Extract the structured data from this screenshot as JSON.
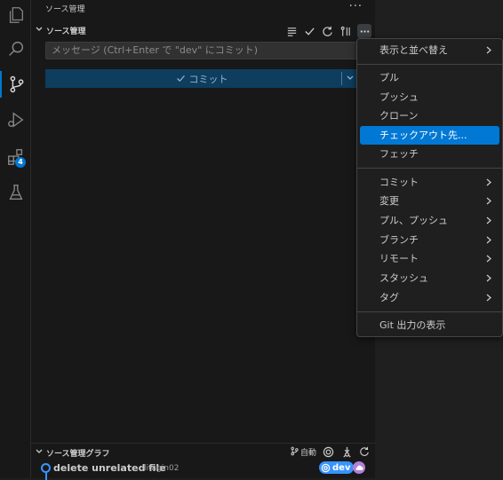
{
  "activity_bar": {
    "items": [
      "files-icon",
      "search-icon",
      "source-control-icon",
      "run-debug-icon",
      "extensions-icon",
      "testing-icon"
    ],
    "extensions_badge": "4"
  },
  "sidebar": {
    "view_title": "ソース管理",
    "section_title": "ソース管理",
    "commit_message_placeholder": "メッセージ (Ctrl+Enter で \"dev\" にコミット)",
    "commit_button_label": "コミット"
  },
  "graph": {
    "title": "ソース管理グラフ",
    "auto_label": "自動",
    "commit": {
      "message": "delete unrelated file",
      "author": "litagin02",
      "branch": "dev"
    }
  },
  "menu": {
    "items": [
      {
        "label": "表示と並べ替え",
        "submenu": true
      },
      {
        "label": "プル"
      },
      {
        "label": "プッシュ"
      },
      {
        "label": "クローン"
      },
      {
        "label": "チェックアウト先...",
        "highlighted": true
      },
      {
        "label": "フェッチ"
      },
      {
        "label": "コミット",
        "submenu": true
      },
      {
        "label": "変更",
        "submenu": true
      },
      {
        "label": "プル、プッシュ",
        "submenu": true
      },
      {
        "label": "ブランチ",
        "submenu": true
      },
      {
        "label": "リモート",
        "submenu": true
      },
      {
        "label": "スタッシュ",
        "submenu": true
      },
      {
        "label": "タグ",
        "submenu": true
      },
      {
        "label": "Git 出力の表示"
      }
    ]
  },
  "colors": {
    "accent": "#0078d4",
    "commit_button_bg": "#0e3d5e",
    "branch_pill": "#3794ff",
    "remote_pill": "#b180d7"
  }
}
